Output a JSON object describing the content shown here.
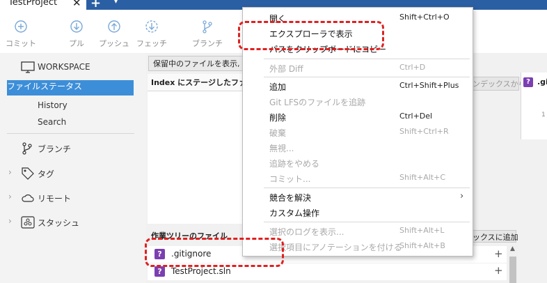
{
  "tab": {
    "title": "TestProject",
    "close": "✕",
    "new_tab": "+",
    "dropdown": "▾"
  },
  "toolbar": {
    "commit": "コミット",
    "pull": "プル",
    "push": "プッシュ",
    "fetch": "フェッチ",
    "branch": "ブランチ"
  },
  "sidebar": {
    "workspace": "WORKSPACE",
    "file_status": "ファイルステータス",
    "history": "History",
    "search": "Search",
    "branches": "ブランチ",
    "tags": "タグ",
    "remotes": "リモート",
    "stashes": "スタッシュ"
  },
  "main": {
    "filter": "保留中のファイルを表示, フ",
    "index_header": "Index にステージしたファイル",
    "remove_from_index": "ンデックスから除く",
    "worktree_header": "作業ツリーのファイル",
    "add_to_index": "ックスに追加",
    "right_tag": ".gi",
    "line_number": "1"
  },
  "files": [
    {
      "name": ".gitignore"
    },
    {
      "name": "TestProject.sln"
    }
  ],
  "menu": {
    "open": "開く",
    "open_sc": "Shift+Ctrl+O",
    "show_in_explorer": "エクスプローラで表示",
    "copy_path": "パスをクリップボードにコピー",
    "external_diff": "外部 Diff",
    "external_diff_sc": "Ctrl+D",
    "add": "追加",
    "add_sc": "Ctrl+Shift+Plus",
    "lfs_track": "Git LFSのファイルを追跡",
    "remove": "削除",
    "remove_sc": "Ctrl+Del",
    "discard": "破棄",
    "discard_sc": "Shift+Ctrl+R",
    "ignore": "無視...",
    "stop_tracking": "追跡をやめる",
    "commit": "コミット...",
    "commit_sc": "Shift+Alt+C",
    "resolve_conflicts": "競合を解決",
    "custom_actions": "カスタム操作",
    "log_selected": "選択のログを表示...",
    "log_selected_sc": "Shift+Alt+L",
    "annotate": "選択項目にアノテーションを付ける",
    "annotate_sc": "Shift+Alt+B"
  },
  "colors": {
    "selection": "#3d8ed8",
    "highlight": "#e02020",
    "untracked_badge": "#7b3fb1",
    "titlebar": "#2b5fa3"
  },
  "icons": {
    "untracked": "?"
  }
}
